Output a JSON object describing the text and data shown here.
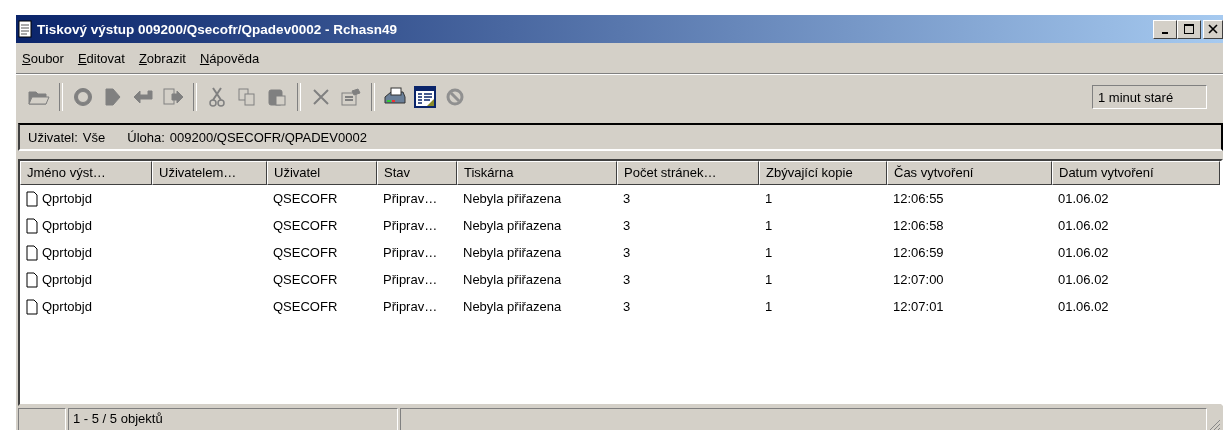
{
  "window": {
    "title": "Tiskový výstup 009200/Qsecofr/Qpadev0002 - Rchasn49"
  },
  "menu": [
    {
      "label": "Soubor"
    },
    {
      "label": "Editovat"
    },
    {
      "label": "Zobrazit"
    },
    {
      "label": "Nápověda"
    }
  ],
  "toolbar": [
    {
      "disabled": true
    },
    {
      "disabled": true
    },
    {
      "disabled": true
    },
    {
      "disabled": true
    },
    {
      "disabled": true
    },
    {
      "disabled": true
    },
    {
      "disabled": true
    },
    {
      "disabled": true
    },
    {
      "disabled": true
    },
    {
      "disabled": true
    },
    {
      "disabled": false
    },
    {
      "disabled": false
    },
    {
      "disabled": true
    }
  ],
  "refresh_status": "1 minut staré",
  "filter": {
    "user_label": "Uživatel:",
    "user_value": "Vše",
    "job_label": "Úloha:",
    "job_value": "009200/QSECOFR/QPADEV0002"
  },
  "table": {
    "columns": [
      "Jméno výst…",
      "Uživatelem…",
      "Uživatel",
      "Stav",
      "Tiskárna",
      "Počet stránek…",
      "Zbývající kopie",
      "Čas vytvoření",
      "Datum vytvoření"
    ],
    "rows": [
      [
        "Qprtobjd",
        "",
        "QSECOFR",
        "Připrav…",
        "Nebyla přiřazena",
        "3",
        "1",
        "12:06:55",
        "01.06.02"
      ],
      [
        "Qprtobjd",
        "",
        "QSECOFR",
        "Připrav…",
        "Nebyla přiřazena",
        "3",
        "1",
        "12:06:58",
        "01.06.02"
      ],
      [
        "Qprtobjd",
        "",
        "QSECOFR",
        "Připrav…",
        "Nebyla přiřazena",
        "3",
        "1",
        "12:06:59",
        "01.06.02"
      ],
      [
        "Qprtobjd",
        "",
        "QSECOFR",
        "Připrav…",
        "Nebyla přiřazena",
        "3",
        "1",
        "12:07:00",
        "01.06.02"
      ],
      [
        "Qprtobjd",
        "",
        "QSECOFR",
        "Připrav…",
        "Nebyla přiřazena",
        "3",
        "1",
        "12:07:01",
        "01.06.02"
      ]
    ]
  },
  "status_bar": {
    "count": "1 - 5 / 5 objektů"
  }
}
